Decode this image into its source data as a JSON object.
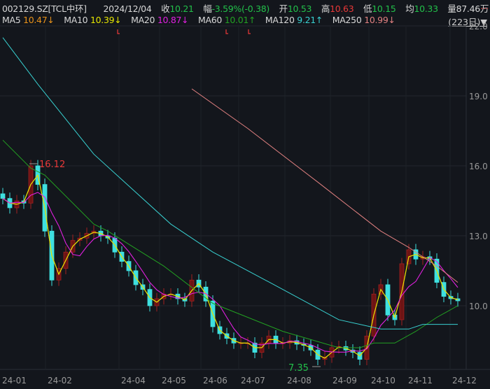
{
  "header": {
    "code": "002129.SZ[TCL中环]",
    "date": "2024/12/04",
    "close_label": "收",
    "close": "10.21",
    "change_label": "幅",
    "change": "-3.59%(-0.38)",
    "open_label": "开",
    "open": "10.53",
    "high_label": "高",
    "high": "10.63",
    "low_label": "低",
    "low": "10.15",
    "avg_label": "均",
    "avg": "10.33",
    "vol_label": "量",
    "vol": "87.46万",
    "more": "..."
  },
  "ma_legend": [
    {
      "label": "MA5",
      "value": "10.47↓",
      "color": "#e8921a"
    },
    {
      "label": "MA10",
      "value": "10.39↓",
      "color": "#e6e600"
    },
    {
      "label": "MA20",
      "value": "10.87↓",
      "color": "#e020e0"
    },
    {
      "label": "MA60",
      "value": "10.01↑",
      "color": "#22a022"
    },
    {
      "label": "MA120",
      "value": "9.21↑",
      "color": "#38d0d0"
    },
    {
      "label": "MA250",
      "value": "10.99↓",
      "color": "#e08080"
    }
  ],
  "period_selector": "(223日)▼",
  "colors": {
    "up": "#e83838",
    "down": "#3ee0e0",
    "background": "#13161c"
  },
  "chart_data": {
    "type": "candlestick",
    "ylim": [
      7,
      22
    ],
    "y_ticks": [
      "22.0",
      "19.0",
      "16.0",
      "13.0",
      "10.0"
    ],
    "x_ticks": [
      "24-01",
      "24-02",
      "24-04",
      "24-05",
      "24-06",
      "24-07",
      "24-08",
      "24-09",
      "24-10",
      "24-11",
      "24-12"
    ],
    "closes": [
      14.6,
      14.2,
      14.5,
      14.4,
      16.0,
      15.2,
      13.2,
      11.1,
      11.6,
      12.3,
      12.8,
      12.9,
      13.1,
      13.2,
      13.0,
      12.9,
      12.3,
      11.9,
      11.5,
      10.9,
      10.7,
      10.0,
      10.3,
      10.5,
      10.5,
      10.3,
      10.2,
      11.1,
      10.8,
      10.2,
      9.1,
      8.8,
      8.6,
      8.4,
      8.4,
      8.4,
      8.0,
      8.4,
      8.7,
      8.4,
      8.4,
      8.5,
      8.35,
      8.3,
      8.1,
      7.7,
      7.8,
      8.2,
      8.25,
      8.1,
      8.0,
      7.7,
      8.7,
      10.5,
      10.9,
      9.6,
      9.4,
      11.8,
      12.4,
      12.0,
      12.1,
      12.0,
      11.0,
      10.4,
      10.3,
      10.21
    ],
    "ma_series": [
      {
        "name": "MA60",
        "points": [
          [
            0,
            17.1
          ],
          [
            4,
            15.9
          ],
          [
            6,
            15.6
          ],
          [
            13,
            13.5
          ],
          [
            15,
            13.2
          ],
          [
            23,
            11.7
          ],
          [
            30,
            10.1
          ],
          [
            40,
            8.9
          ],
          [
            48,
            8.2
          ],
          [
            51,
            8.2
          ],
          [
            53,
            8.4
          ],
          [
            56,
            8.4
          ],
          [
            59,
            8.9
          ],
          [
            62,
            9.5
          ],
          [
            65,
            10.0
          ]
        ]
      },
      {
        "name": "MA120",
        "points": [
          [
            0,
            21.5
          ],
          [
            5,
            19.5
          ],
          [
            13,
            16.5
          ],
          [
            24,
            13.5
          ],
          [
            30,
            12.3
          ],
          [
            40,
            10.7
          ],
          [
            48,
            9.4
          ],
          [
            54,
            9.0
          ],
          [
            58,
            9.0
          ],
          [
            60,
            9.2
          ],
          [
            65,
            9.2
          ]
        ]
      },
      {
        "name": "MA250",
        "points": [
          [
            27,
            19.3
          ],
          [
            35,
            17.6
          ],
          [
            45,
            15.3
          ],
          [
            54,
            13.2
          ],
          [
            58,
            12.5
          ],
          [
            62,
            11.7
          ],
          [
            65,
            11.0
          ]
        ]
      }
    ],
    "annotations": [
      {
        "text": "16.12",
        "kind": "high"
      },
      {
        "text": "7.35",
        "kind": "low"
      }
    ]
  }
}
